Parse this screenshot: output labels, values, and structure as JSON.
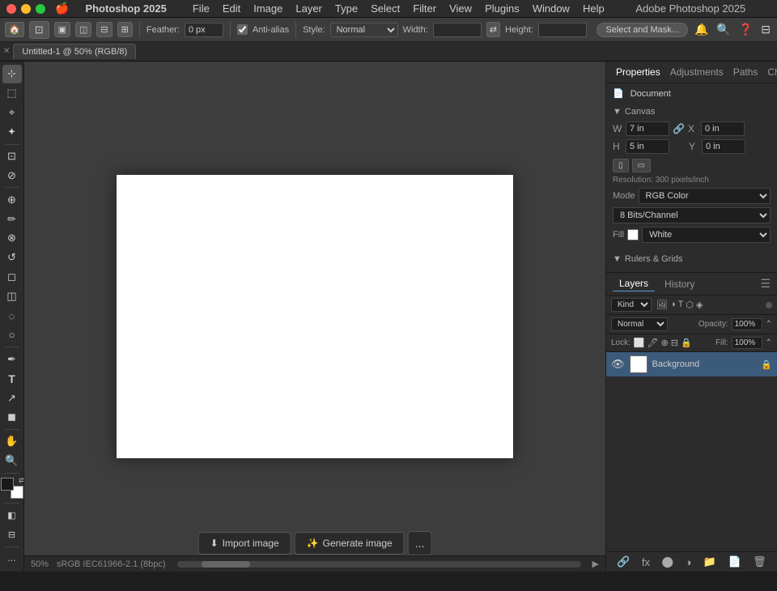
{
  "app": {
    "name": "Photoshop 2025",
    "window_title": "Adobe Photoshop 2025",
    "tab_title": "Untitled-1 @ 50% (RGB/8)"
  },
  "menubar": {
    "apple": "⌘",
    "items": [
      "Photoshop 2025",
      "File",
      "Edit",
      "Image",
      "Layer",
      "Type",
      "Select",
      "Filter",
      "View",
      "Plugins",
      "Window",
      "Help"
    ]
  },
  "options_bar": {
    "feather_label": "Feather:",
    "feather_value": "0 px",
    "anti_alias_label": "Anti-alias",
    "style_label": "Style:",
    "style_value": "Normal",
    "width_label": "Width:",
    "height_label": "Height:",
    "mask_button": "Select and Mask..."
  },
  "toolbar": {
    "tools": [
      {
        "name": "move",
        "icon": "⊹",
        "label": "Move Tool"
      },
      {
        "name": "select-rectangle",
        "icon": "⬜",
        "label": "Rectangular Marquee"
      },
      {
        "name": "lasso",
        "icon": "⌖",
        "label": "Lasso"
      },
      {
        "name": "magic-wand",
        "icon": "✦",
        "label": "Magic Wand"
      },
      {
        "name": "crop",
        "icon": "⊡",
        "label": "Crop"
      },
      {
        "name": "eyedropper",
        "icon": "⊘",
        "label": "Eyedropper"
      },
      {
        "name": "healing",
        "icon": "⊕",
        "label": "Healing Brush"
      },
      {
        "name": "brush",
        "icon": "✏",
        "label": "Brush"
      },
      {
        "name": "clone",
        "icon": "⊗",
        "label": "Clone Stamp"
      },
      {
        "name": "history-brush",
        "icon": "↺",
        "label": "History Brush"
      },
      {
        "name": "eraser",
        "icon": "◻",
        "label": "Eraser"
      },
      {
        "name": "gradient",
        "icon": "◫",
        "label": "Gradient"
      },
      {
        "name": "blur",
        "icon": "◌",
        "label": "Blur"
      },
      {
        "name": "dodge",
        "icon": "○",
        "label": "Dodge"
      },
      {
        "name": "pen",
        "icon": "✒",
        "label": "Pen"
      },
      {
        "name": "type",
        "icon": "T",
        "label": "Type"
      },
      {
        "name": "path-select",
        "icon": "↗",
        "label": "Path Selection"
      },
      {
        "name": "shape",
        "icon": "◼",
        "label": "Shape"
      },
      {
        "name": "hand",
        "icon": "✋",
        "label": "Hand"
      },
      {
        "name": "zoom",
        "icon": "⊕",
        "label": "Zoom"
      }
    ]
  },
  "properties": {
    "tabs": [
      "Properties",
      "Adjustments",
      "Paths",
      "Channels"
    ],
    "active_tab": "Properties",
    "document_section": "Document",
    "canvas": {
      "label": "Canvas",
      "w_label": "W",
      "w_value": "7 in",
      "h_label": "H",
      "h_value": "5 in",
      "x_label": "X",
      "x_value": "0 in",
      "y_label": "Y",
      "y_value": "0 in",
      "resolution": "Resolution: 300 pixels/inch",
      "mode_label": "Mode",
      "mode_value": "RGB Color",
      "bit_depth": "8 Bits/Channel",
      "fill_label": "Fill",
      "fill_color": "White",
      "fill_swatch": "#ffffff"
    },
    "rulers_grids": "Rulers & Grids"
  },
  "layers": {
    "tabs": [
      "Layers",
      "History"
    ],
    "active_tab": "Layers",
    "kind_label": "Kind",
    "blending_label": "Normal",
    "opacity_label": "Opacity:",
    "opacity_value": "100%",
    "lock_label": "Lock:",
    "fill_label": "Fill:",
    "fill_value": "100%",
    "items": [
      {
        "name": "Background",
        "visible": true,
        "locked": true,
        "thumb_color": "#ffffff"
      }
    ],
    "footer_icons": [
      "link-icon",
      "fx-icon",
      "mask-icon",
      "adjustment-icon",
      "group-icon",
      "new-layer-icon",
      "delete-icon"
    ]
  },
  "canvas": {
    "zoom": "50%",
    "color_profile": "sRGB IEC61966-2.1 (8bpc)"
  },
  "bottom_toolbar": {
    "import_button": "Import image",
    "generate_button": "Generate image",
    "more_button": "..."
  }
}
